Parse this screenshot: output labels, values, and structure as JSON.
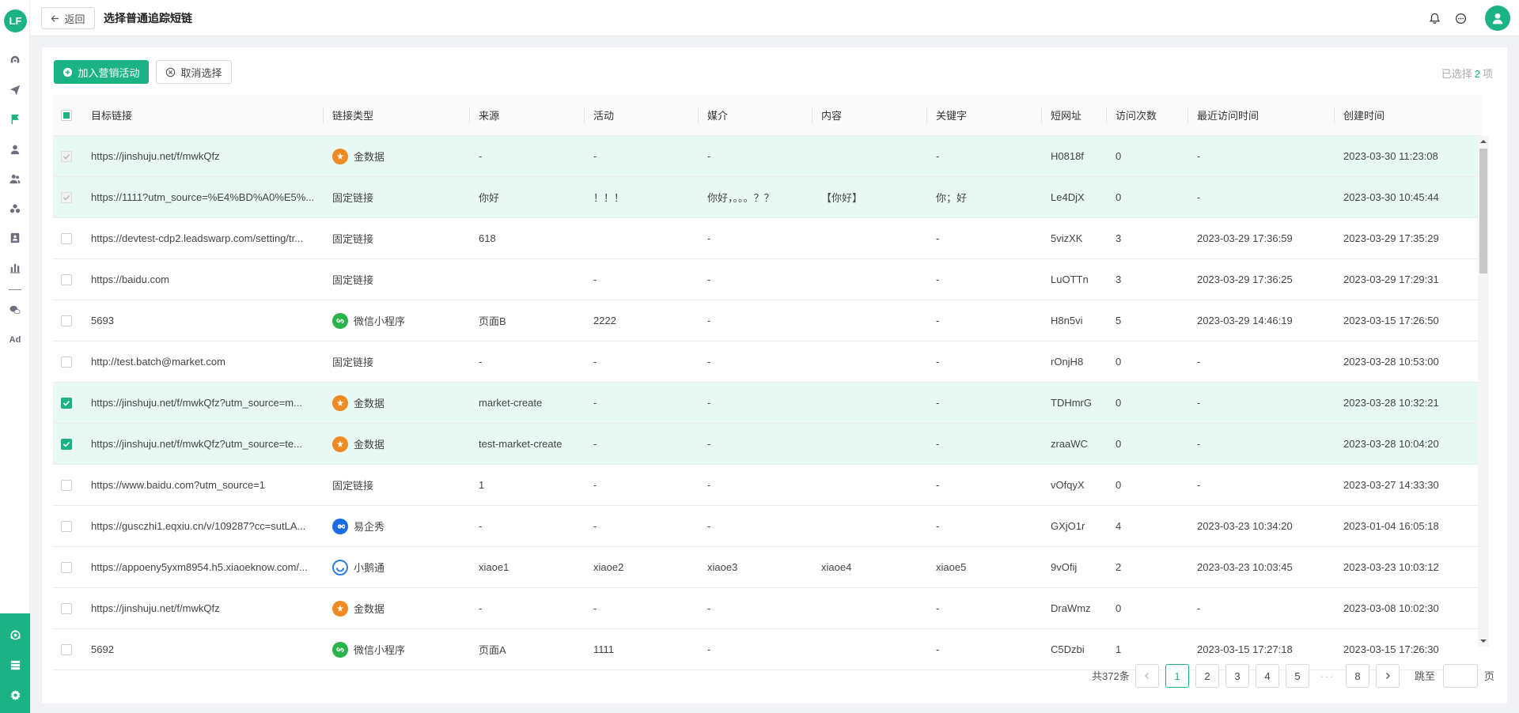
{
  "sidebar": {
    "logo_text": "LF",
    "nav_icons": [
      "dashboard-icon",
      "send-icon",
      "flag-icon",
      "user-icon",
      "users-icon",
      "segments-icon",
      "contacts-book-icon",
      "bar-chart-icon",
      "wechat-icon",
      "ad-icon"
    ],
    "ad_label": "Ad",
    "bottom_icons": [
      "integration-icon",
      "server-icon",
      "settings-gear-icon"
    ],
    "accent": "#1bb386"
  },
  "header": {
    "back_label": "返回",
    "title": "选择普通追踪短链",
    "icons": [
      "bell-icon",
      "chat-bubble-icon",
      "user-avatar-icon"
    ]
  },
  "toolbar": {
    "add_label": "加入营销活动",
    "cancel_label": "取消选择",
    "selected_prefix": "已选择",
    "selected_count": "2",
    "selected_suffix": "项"
  },
  "table": {
    "columns": [
      "目标链接",
      "链接类型",
      "来源",
      "活动",
      "媒介",
      "内容",
      "关键字",
      "短网址",
      "访问次数",
      "最近访问时间",
      "创建时间"
    ],
    "rows": [
      {
        "state": "disabled",
        "url": "https://jinshuju.net/f/mwkQfz",
        "type": "金数据",
        "type_icon": "jin",
        "source": "-",
        "campaign": "-",
        "medium": "-",
        "content": "",
        "keyword": "-",
        "short": "H0818f",
        "visits": "0",
        "last_visit": "-",
        "created": "2023-03-30 11:23:08"
      },
      {
        "state": "disabled",
        "url": "https://1111?utm_source=%E4%BD%A0%E5%...",
        "type": "固定链接",
        "type_icon": "",
        "source": "你好",
        "campaign": "！！！",
        "medium": "你好，。。。？？",
        "content": "【你好】",
        "keyword": "你；好",
        "short": "Le4DjX",
        "visits": "0",
        "last_visit": "-",
        "created": "2023-03-30 10:45:44"
      },
      {
        "state": "unchecked",
        "url": "https://devtest-cdp2.leadswarp.com/setting/tr...",
        "type": "固定链接",
        "type_icon": "",
        "source": "618",
        "campaign": "",
        "medium": "-",
        "content": "",
        "keyword": "-",
        "short": "5vizXK",
        "visits": "3",
        "last_visit": "2023-03-29 17:36:59",
        "created": "2023-03-29 17:35:29"
      },
      {
        "state": "unchecked",
        "url": "https://baidu.com",
        "type": "固定链接",
        "type_icon": "",
        "source": "",
        "campaign": "-",
        "medium": "-",
        "content": "",
        "keyword": "-",
        "short": "LuOTTn",
        "visits": "3",
        "last_visit": "2023-03-29 17:36:25",
        "created": "2023-03-29 17:29:31"
      },
      {
        "state": "unchecked",
        "url": "5693",
        "type": "微信小程序",
        "type_icon": "wx",
        "source": "页面B",
        "campaign": "2222",
        "medium": "-",
        "content": "",
        "keyword": "-",
        "short": "H8n5vi",
        "visits": "5",
        "last_visit": "2023-03-29 14:46:19",
        "created": "2023-03-15 17:26:50"
      },
      {
        "state": "unchecked",
        "url": "http://test.batch@market.com",
        "type": "固定链接",
        "type_icon": "",
        "source": "-",
        "campaign": "-",
        "medium": "-",
        "content": "",
        "keyword": "-",
        "short": "rOnjH8",
        "visits": "0",
        "last_visit": "-",
        "created": "2023-03-28 10:53:00"
      },
      {
        "state": "checked",
        "url": "https://jinshuju.net/f/mwkQfz?utm_source=m...",
        "type": "金数据",
        "type_icon": "jin",
        "source": "market-create",
        "campaign": "-",
        "medium": "-",
        "content": "",
        "keyword": "-",
        "short": "TDHmrG",
        "visits": "0",
        "last_visit": "-",
        "created": "2023-03-28 10:32:21"
      },
      {
        "state": "checked",
        "url": "https://jinshuju.net/f/mwkQfz?utm_source=te...",
        "type": "金数据",
        "type_icon": "jin",
        "source": "test-market-create",
        "campaign": "-",
        "medium": "-",
        "content": "",
        "keyword": "-",
        "short": "zraaWC",
        "visits": "0",
        "last_visit": "-",
        "created": "2023-03-28 10:04:20"
      },
      {
        "state": "unchecked",
        "url": "https://www.baidu.com?utm_source=1",
        "type": "固定链接",
        "type_icon": "",
        "source": "1",
        "campaign": "-",
        "medium": "-",
        "content": "",
        "keyword": "-",
        "short": "vOfqyX",
        "visits": "0",
        "last_visit": "-",
        "created": "2023-03-27 14:33:30"
      },
      {
        "state": "unchecked",
        "url": "https://gusczhi1.eqxiu.cn/v/109287?cc=sutLA...",
        "type": "易企秀",
        "type_icon": "yi",
        "source": "-",
        "campaign": "-",
        "medium": "-",
        "content": "",
        "keyword": "-",
        "short": "GXjO1r",
        "visits": "4",
        "last_visit": "2023-03-23 10:34:20",
        "created": "2023-01-04 16:05:18"
      },
      {
        "state": "unchecked",
        "url": "https://appoeny5yxm8954.h5.xiaoeknow.com/...",
        "type": "小鹅通",
        "type_icon": "xe",
        "source": "xiaoe1",
        "campaign": "xiaoe2",
        "medium": "xiaoe3",
        "content": "xiaoe4",
        "keyword": "xiaoe5",
        "short": "9vOfij",
        "visits": "2",
        "last_visit": "2023-03-23 10:03:45",
        "created": "2023-03-23 10:03:12"
      },
      {
        "state": "unchecked",
        "url": "https://jinshuju.net/f/mwkQfz",
        "type": "金数据",
        "type_icon": "jin",
        "source": "-",
        "campaign": "-",
        "medium": "-",
        "content": "",
        "keyword": "-",
        "short": "DraWmz",
        "visits": "0",
        "last_visit": "-",
        "created": "2023-03-08 10:02:30"
      },
      {
        "state": "unchecked",
        "url": "5692",
        "type": "微信小程序",
        "type_icon": "wx",
        "source": "页面A",
        "campaign": "1111",
        "medium": "-",
        "content": "",
        "keyword": "-",
        "short": "C5Dzbi",
        "visits": "1",
        "last_visit": "2023-03-15 17:27:18",
        "created": "2023-03-15 17:26:30"
      }
    ]
  },
  "pagination": {
    "total_label": "共372条",
    "pages": [
      "1",
      "2",
      "3",
      "4",
      "5"
    ],
    "current": "1",
    "ellipsis": "···",
    "last_page": "8",
    "jump_label": "跳至",
    "page_suffix": "页"
  }
}
